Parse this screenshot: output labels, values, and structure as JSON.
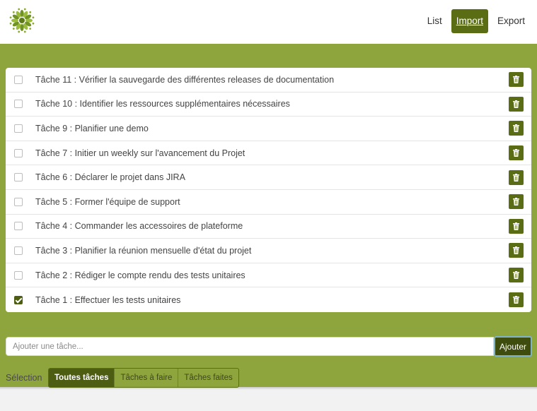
{
  "nav": {
    "items": [
      {
        "label": "List",
        "active": false
      },
      {
        "label": "Import",
        "active": true
      },
      {
        "label": "Export",
        "active": false
      }
    ]
  },
  "colors": {
    "band": "#8ea43d",
    "accent": "#5a6d14",
    "accent_dark": "#4d5e12"
  },
  "tasks": [
    {
      "label": "Tâche 11 : Vérifier la sauvegarde des différentes releases de documentation",
      "done": false
    },
    {
      "label": "Tâche 10 : Identifier les ressources supplémentaires nécessaires",
      "done": false
    },
    {
      "label": "Tâche 9 : Planifier une demo",
      "done": false
    },
    {
      "label": "Tâche 7 : Initier un weekly sur l'avancement du Projet",
      "done": false
    },
    {
      "label": "Tâche 6 : Déclarer le projet dans JIRA",
      "done": false
    },
    {
      "label": "Tâche 5 : Former l'équipe de support",
      "done": false
    },
    {
      "label": "Tâche 4 : Commander les accessoires de plateforme",
      "done": false
    },
    {
      "label": "Tâche 3 : Planifier la réunion mensuelle d'état du projet",
      "done": false
    },
    {
      "label": "Tâche 2 : Rédiger le compte rendu des tests unitaires",
      "done": false
    },
    {
      "label": "Tâche 1 : Effectuer les tests unitaires",
      "done": true
    }
  ],
  "add": {
    "placeholder": "Ajouter une tâche...",
    "value": "",
    "button_label": "Ajouter"
  },
  "selection": {
    "label": "Sélection",
    "filters": [
      {
        "label": "Toutes tâches",
        "active": true
      },
      {
        "label": "Tâches à faire",
        "active": false
      },
      {
        "label": "Tâches faites",
        "active": false
      }
    ]
  },
  "icons": {
    "logo": "green-flower-logo-icon",
    "delete": "trash-icon",
    "check": "checkbox-icon"
  }
}
